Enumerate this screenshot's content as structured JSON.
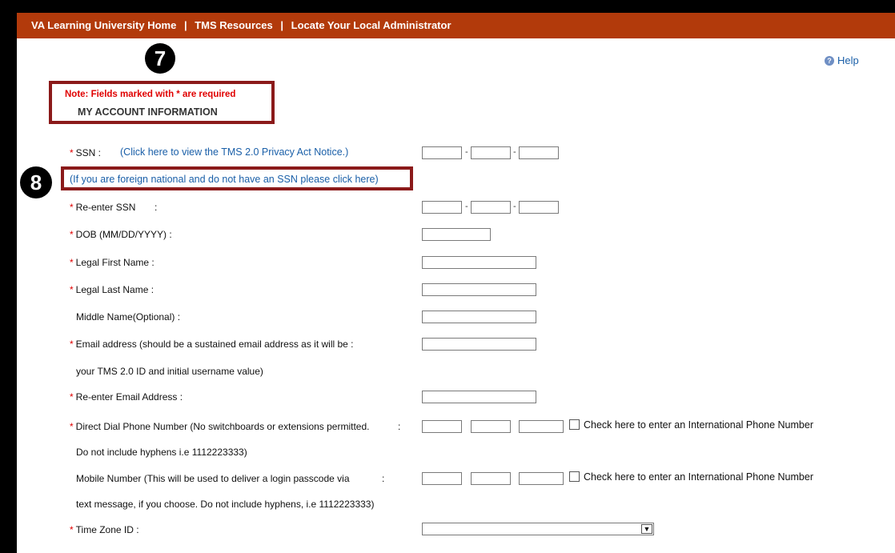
{
  "nav": {
    "home": "VA Learning University Home",
    "resources": "TMS Resources",
    "locate_admin": "Locate Your Local Administrator",
    "separator": "|"
  },
  "help": {
    "label": "Help",
    "icon": "help-icon"
  },
  "callouts": {
    "step7": "7",
    "step8": "8"
  },
  "note": "Note: Fields marked with * are required",
  "section_title": "MY ACCOUNT INFORMATION",
  "required_marker": "*",
  "fields": {
    "ssn": "SSN :",
    "privacy_link": "(Click here to view the TMS 2.0 Privacy Act Notice.)",
    "foreign_link": "(If you are foreign national and do not have an SSN please click here)",
    "reenter_ssn": "Re-enter SSN",
    "reenter_ssn_colon": ":",
    "dob": "DOB (MM/DD/YYYY) :",
    "first_name": "Legal First Name :",
    "last_name": "Legal Last Name :",
    "middle_name": "Middle Name(Optional) :",
    "email_line1": "Email address (should be a sustained email address as it will be :",
    "email_line2": "your TMS 2.0 ID and initial username value)",
    "reenter_email": "Re-enter Email Address :",
    "phone_line1": "Direct Dial Phone Number (No switchboards or extensions permitted.",
    "phone_colon": ":",
    "phone_line2": "Do not include hyphens i.e 1112223333)",
    "mobile_line1": "Mobile Number (This will be used to deliver a login passcode via",
    "mobile_colon": ":",
    "mobile_line2": "text message, if you choose. Do not include hyphens, i.e 1112223333)",
    "timezone": "Time Zone ID :"
  },
  "dash": "-",
  "intl_phone_label": "Check here to enter an International Phone Number",
  "timezone_selected": "",
  "colors": {
    "topbar": "#b23a0b",
    "link": "#1a5fa8",
    "required": "#e00000",
    "callout_border": "#8b1a1a"
  }
}
